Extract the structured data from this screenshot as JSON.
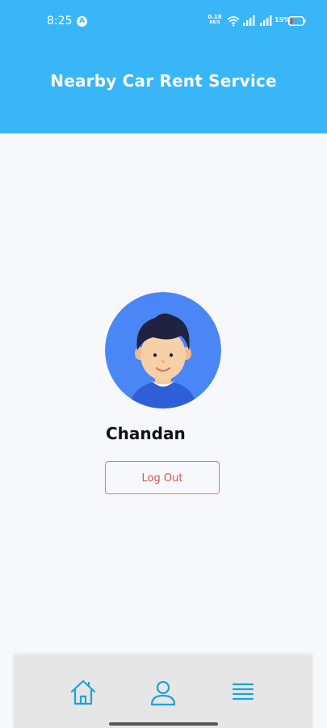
{
  "status_bar": {
    "time": "8:25",
    "app_badge": "A",
    "net_speed_value": "0.18",
    "net_speed_unit": "KB/S",
    "battery_percent": "15%"
  },
  "app_bar": {
    "title": "Nearby Car Rent Service"
  },
  "profile": {
    "name": "Chandan",
    "logout_label": "Log Out",
    "avatar_icon": "user-avatar-icon"
  },
  "bottom_nav": {
    "items": [
      {
        "icon": "home-icon"
      },
      {
        "icon": "user-icon"
      },
      {
        "icon": "menu-icon"
      }
    ]
  },
  "colors": {
    "primary": "#38b6f7",
    "accent_nav": "#1aa3d9",
    "logout": "#d9534f",
    "avatar_bg": "#4a86f5"
  }
}
